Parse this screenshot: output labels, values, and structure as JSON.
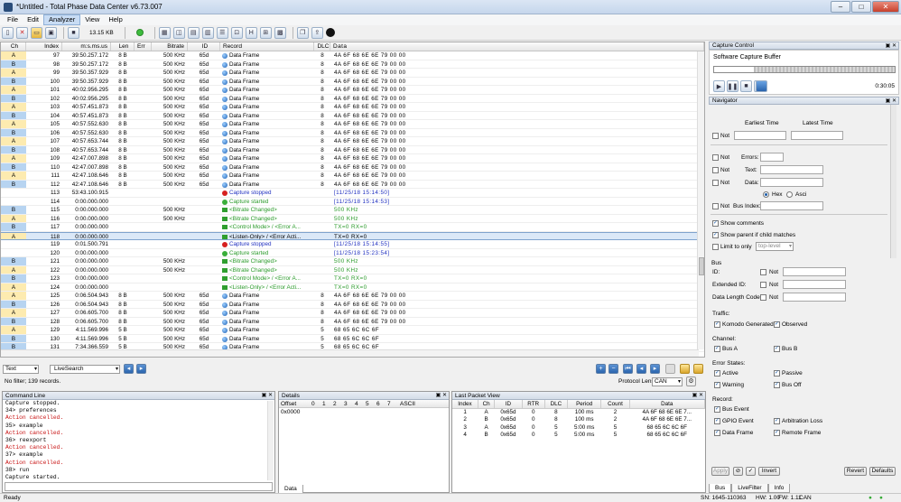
{
  "window": {
    "title": "*Untitled - Total Phase Data Center v6.73.007"
  },
  "menu": [
    "File",
    "Edit",
    "Analyzer",
    "View",
    "Help"
  ],
  "toolbar": {
    "buffer_size": "13.15 KB"
  },
  "grid": {
    "headers": [
      "Ch",
      "Index",
      "m:s.ms.us",
      "Len",
      "Err",
      "Bitrate",
      "ID",
      "Record",
      "DLC",
      "Data"
    ],
    "rows": [
      {
        "ch": "A",
        "idx": "97",
        "ts": "39:50.257.172",
        "len": "8 B",
        "br": "500 KHz",
        "id": "65d",
        "rec": "Data Frame",
        "dlc": "8",
        "data": "4A 6F 68 6E 6E 79 00 00",
        "icon": "blue"
      },
      {
        "ch": "B",
        "idx": "98",
        "ts": "39:50.257.172",
        "len": "8 B",
        "br": "500 KHz",
        "id": "65d",
        "rec": "Data Frame",
        "dlc": "8",
        "data": "4A 6F 68 6E 6E 79 00 00",
        "icon": "blue"
      },
      {
        "ch": "A",
        "idx": "99",
        "ts": "39:50.357.929",
        "len": "8 B",
        "br": "500 KHz",
        "id": "65d",
        "rec": "Data Frame",
        "dlc": "8",
        "data": "4A 6F 68 6E 6E 79 00 00",
        "icon": "blue"
      },
      {
        "ch": "B",
        "idx": "100",
        "ts": "39:50.357.929",
        "len": "8 B",
        "br": "500 KHz",
        "id": "65d",
        "rec": "Data Frame",
        "dlc": "8",
        "data": "4A 6F 68 6E 6E 79 00 00",
        "icon": "blue"
      },
      {
        "ch": "A",
        "idx": "101",
        "ts": "40:02.956.295",
        "len": "8 B",
        "br": "500 KHz",
        "id": "65d",
        "rec": "Data Frame",
        "dlc": "8",
        "data": "4A 6F 68 6E 6E 79 00 00",
        "icon": "blue"
      },
      {
        "ch": "B",
        "idx": "102",
        "ts": "40:02.956.295",
        "len": "8 B",
        "br": "500 KHz",
        "id": "65d",
        "rec": "Data Frame",
        "dlc": "8",
        "data": "4A 6F 68 6E 6E 79 00 00",
        "icon": "blue"
      },
      {
        "ch": "A",
        "idx": "103",
        "ts": "40:57.451.873",
        "len": "8 B",
        "br": "500 KHz",
        "id": "65d",
        "rec": "Data Frame",
        "dlc": "8",
        "data": "4A 6F 68 6E 6E 79 00 00",
        "icon": "blue"
      },
      {
        "ch": "B",
        "idx": "104",
        "ts": "40:57.451.873",
        "len": "8 B",
        "br": "500 KHz",
        "id": "65d",
        "rec": "Data Frame",
        "dlc": "8",
        "data": "4A 6F 68 6E 6E 79 00 00",
        "icon": "blue"
      },
      {
        "ch": "A",
        "idx": "105",
        "ts": "40:57.552.630",
        "len": "8 B",
        "br": "500 KHz",
        "id": "65d",
        "rec": "Data Frame",
        "dlc": "8",
        "data": "4A 6F 68 6E 6E 79 00 00",
        "icon": "blue"
      },
      {
        "ch": "B",
        "idx": "106",
        "ts": "40:57.552.630",
        "len": "8 B",
        "br": "500 KHz",
        "id": "65d",
        "rec": "Data Frame",
        "dlc": "8",
        "data": "4A 6F 68 6E 6E 79 00 00",
        "icon": "blue"
      },
      {
        "ch": "A",
        "idx": "107",
        "ts": "40:57.653.744",
        "len": "8 B",
        "br": "500 KHz",
        "id": "65d",
        "rec": "Data Frame",
        "dlc": "8",
        "data": "4A 6F 68 6E 6E 79 00 00",
        "icon": "blue"
      },
      {
        "ch": "B",
        "idx": "108",
        "ts": "40:57.653.744",
        "len": "8 B",
        "br": "500 KHz",
        "id": "65d",
        "rec": "Data Frame",
        "dlc": "8",
        "data": "4A 6F 68 6E 6E 79 00 00",
        "icon": "blue"
      },
      {
        "ch": "A",
        "idx": "109",
        "ts": "42:47.007.898",
        "len": "8 B",
        "br": "500 KHz",
        "id": "65d",
        "rec": "Data Frame",
        "dlc": "8",
        "data": "4A 6F 68 6E 6E 79 00 00",
        "icon": "blue"
      },
      {
        "ch": "B",
        "idx": "110",
        "ts": "42:47.007.898",
        "len": "8 B",
        "br": "500 KHz",
        "id": "65d",
        "rec": "Data Frame",
        "dlc": "8",
        "data": "4A 6F 68 6E 6E 79 00 00",
        "icon": "blue"
      },
      {
        "ch": "A",
        "idx": "111",
        "ts": "42:47.108.646",
        "len": "8 B",
        "br": "500 KHz",
        "id": "65d",
        "rec": "Data Frame",
        "dlc": "8",
        "data": "4A 6F 68 6E 6E 79 00 00",
        "icon": "blue"
      },
      {
        "ch": "B",
        "idx": "112",
        "ts": "42:47.108.646",
        "len": "8 B",
        "br": "500 KHz",
        "id": "65d",
        "rec": "Data Frame",
        "dlc": "8",
        "data": "4A 6F 68 6E 6E 79 00 00",
        "icon": "blue"
      },
      {
        "ch": "",
        "idx": "113",
        "ts": "53:43.100.915",
        "len": "",
        "br": "",
        "id": "",
        "rec": "Capture stopped",
        "dlc": "",
        "data": "[11/25/18 15:14:50]",
        "icon": "red",
        "style": "stop"
      },
      {
        "ch": "",
        "idx": "114",
        "ts": "0:00.000.000",
        "len": "",
        "br": "",
        "id": "",
        "rec": "Capture started",
        "dlc": "",
        "data": "[11/25/18 15:14:53]",
        "icon": "green",
        "style": "start"
      },
      {
        "ch": "B",
        "idx": "115",
        "ts": "0:00.000.000",
        "len": "",
        "br": "500 KHz",
        "id": "",
        "rec": "<Bitrate Changed>",
        "dlc": "",
        "data": "500 KHz",
        "icon": "flag",
        "style": "info"
      },
      {
        "ch": "A",
        "idx": "116",
        "ts": "0:00.000.000",
        "len": "",
        "br": "500 KHz",
        "id": "",
        "rec": "<Bitrate Changed>",
        "dlc": "",
        "data": "500 KHz",
        "icon": "flag",
        "style": "info"
      },
      {
        "ch": "B",
        "idx": "117",
        "ts": "0:00.000.000",
        "len": "",
        "br": "",
        "id": "",
        "rec": "<Control Mode> / <Error A...",
        "dlc": "",
        "data": "TX=0 RX=0",
        "icon": "flag",
        "style": "info"
      },
      {
        "ch": "A",
        "idx": "118",
        "ts": "0:00.000.000",
        "len": "",
        "br": "",
        "id": "",
        "rec": "<Listen-Only> / <Error Acti...",
        "dlc": "",
        "data": "TX=0 RX=0",
        "icon": "flag",
        "style": "hl"
      },
      {
        "ch": "",
        "idx": "119",
        "ts": "0:01.500.791",
        "len": "",
        "br": "",
        "id": "",
        "rec": "Capture stopped",
        "dlc": "",
        "data": "[11/25/18 15:14:55]",
        "icon": "red",
        "style": "stop"
      },
      {
        "ch": "",
        "idx": "120",
        "ts": "0:00.000.000",
        "len": "",
        "br": "",
        "id": "",
        "rec": "Capture started",
        "dlc": "",
        "data": "[11/25/18 15:23:54]",
        "icon": "green",
        "style": "start"
      },
      {
        "ch": "B",
        "idx": "121",
        "ts": "0:00.000.000",
        "len": "",
        "br": "500 KHz",
        "id": "",
        "rec": "<Bitrate Changed>",
        "dlc": "",
        "data": "500 KHz",
        "icon": "flag",
        "style": "info"
      },
      {
        "ch": "A",
        "idx": "122",
        "ts": "0:00.000.000",
        "len": "",
        "br": "500 KHz",
        "id": "",
        "rec": "<Bitrate Changed>",
        "dlc": "",
        "data": "500 KHz",
        "icon": "flag",
        "style": "info"
      },
      {
        "ch": "B",
        "idx": "123",
        "ts": "0:00.000.000",
        "len": "",
        "br": "",
        "id": "",
        "rec": "<Control Mode> / <Error A...",
        "dlc": "",
        "data": "TX=0 RX=0",
        "icon": "flag",
        "style": "info"
      },
      {
        "ch": "A",
        "idx": "124",
        "ts": "0:00.000.000",
        "len": "",
        "br": "",
        "id": "",
        "rec": "<Listen-Only> / <Error Acti...",
        "dlc": "",
        "data": "TX=0 RX=0",
        "icon": "flag",
        "style": "info"
      },
      {
        "ch": "A",
        "idx": "125",
        "ts": "0:06.504.943",
        "len": "8 B",
        "br": "500 KHz",
        "id": "65d",
        "rec": "Data Frame",
        "dlc": "8",
        "data": "4A 6F 68 6E 6E 79 00 00",
        "icon": "blue"
      },
      {
        "ch": "B",
        "idx": "126",
        "ts": "0:06.504.943",
        "len": "8 B",
        "br": "500 KHz",
        "id": "65d",
        "rec": "Data Frame",
        "dlc": "8",
        "data": "4A 6F 68 6E 6E 79 00 00",
        "icon": "blue"
      },
      {
        "ch": "A",
        "idx": "127",
        "ts": "0:06.605.700",
        "len": "8 B",
        "br": "500 KHz",
        "id": "65d",
        "rec": "Data Frame",
        "dlc": "8",
        "data": "4A 6F 68 6E 6E 79 00 00",
        "icon": "blue"
      },
      {
        "ch": "B",
        "idx": "128",
        "ts": "0:06.605.700",
        "len": "8 B",
        "br": "500 KHz",
        "id": "65d",
        "rec": "Data Frame",
        "dlc": "8",
        "data": "4A 6F 68 6E 6E 79 00 00",
        "icon": "blue"
      },
      {
        "ch": "A",
        "idx": "129",
        "ts": "4:11.569.996",
        "len": "5 B",
        "br": "500 KHz",
        "id": "65d",
        "rec": "Data Frame",
        "dlc": "5",
        "data": "68 65 6C 6C 6F",
        "icon": "blue"
      },
      {
        "ch": "B",
        "idx": "130",
        "ts": "4:11.569.996",
        "len": "5 B",
        "br": "500 KHz",
        "id": "65d",
        "rec": "Data Frame",
        "dlc": "5",
        "data": "68 65 6C 6C 6F",
        "icon": "blue"
      },
      {
        "ch": "B",
        "idx": "131",
        "ts": "7:34.366.559",
        "len": "5 B",
        "br": "500 KHz",
        "id": "65d",
        "rec": "Data Frame",
        "dlc": "5",
        "data": "68 65 6C 6C 6F",
        "icon": "blue"
      }
    ]
  },
  "filter": {
    "mode": "Text",
    "search_mode": "LiveSearch",
    "protocol_label": "Protocol Lens:",
    "protocol_value": "CAN",
    "summary": "No filter; 139 records."
  },
  "command_line": {
    "title": "Command Line",
    "lines": [
      {
        "t": "Capture stopped.",
        "red": false
      },
      {
        "t": "34> preferences",
        "red": false
      },
      {
        "t": "Action cancelled.",
        "red": true
      },
      {
        "t": "35> example",
        "red": false
      },
      {
        "t": "Action cancelled.",
        "red": true
      },
      {
        "t": "36> reexport",
        "red": false
      },
      {
        "t": "Action cancelled.",
        "red": true
      },
      {
        "t": "37> example",
        "red": false
      },
      {
        "t": "Action cancelled.",
        "red": true
      },
      {
        "t": "38> run",
        "red": false
      },
      {
        "t": "Capture started.",
        "red": false
      }
    ]
  },
  "details": {
    "title": "Details",
    "offset_label": "Offset",
    "cols": [
      "0",
      "1",
      "2",
      "3",
      "4",
      "5",
      "6",
      "7"
    ],
    "ascii_label": "ASCII",
    "offset0": "0x0000",
    "tab": "Data"
  },
  "last_packet": {
    "title": "Last Packet View",
    "headers": [
      "Index",
      "Ch",
      "ID",
      "RTR",
      "DLC",
      "Period",
      "Count",
      "Data"
    ],
    "rows": [
      [
        "1",
        "A",
        "0x65d",
        "0",
        "8",
        "100 ms",
        "2",
        "4A 6F 68 6E 6E 7..."
      ],
      [
        "2",
        "B",
        "0x65d",
        "0",
        "8",
        "100 ms",
        "2",
        "4A 6F 68 6E 6E 7..."
      ],
      [
        "3",
        "A",
        "0x65d",
        "0",
        "5",
        "5:00 ms",
        "5",
        "68 65 6C 6C 6F"
      ],
      [
        "4",
        "B",
        "0x65d",
        "0",
        "5",
        "5:00 ms",
        "5",
        "68 65 6C 6C 6F"
      ]
    ]
  },
  "capture": {
    "title": "Capture Control",
    "buffer_label": "Software Capture Buffer",
    "elapsed": "0:30:05",
    "progress": 0.22
  },
  "navigator": {
    "title": "Navigator",
    "earliest": "Earliest Time",
    "latest": "Latest Time",
    "not": "Not",
    "errors": "Errors:",
    "text": "Text:",
    "data": "Data:",
    "hex": "Hex",
    "ascii": "Asci",
    "bus_index": "Bus Index:",
    "show_comments": "Show comments",
    "show_parent": "Show parent if child matches",
    "limit_to": "Limit to only",
    "level": "top-level"
  },
  "bus": {
    "title": "Bus",
    "id": "ID:",
    "ext_id": "Extended ID:",
    "dlc": "Data Length Code:",
    "not": "Not",
    "traffic": "Traffic:",
    "komodo": "Komodo Generated",
    "observed": "Observed",
    "channel": "Channel:",
    "bus_a": "Bus A",
    "bus_b": "Bus B",
    "error_states": "Error States:",
    "active": "Active",
    "passive": "Passive",
    "warning": "Warning",
    "bus_off": "Bus Off",
    "record": "Record:",
    "bus_event": "Bus Event",
    "gpio_event": "GPIO Event",
    "arb_loss": "Arbitration Loss",
    "data_frame": "Data Frame",
    "remote_frame": "Remote Frame",
    "apply": "Apply",
    "invert": "Invert",
    "revert": "Revert",
    "defaults": "Defaults",
    "tabs": [
      "Bus",
      "LiveFilter",
      "Info"
    ]
  },
  "status": {
    "left": "Ready",
    "sn": "SN: 1645-110363",
    "hw": "HW: 1.00",
    "fw": "FW: 1.11",
    "proto": "CAN"
  }
}
